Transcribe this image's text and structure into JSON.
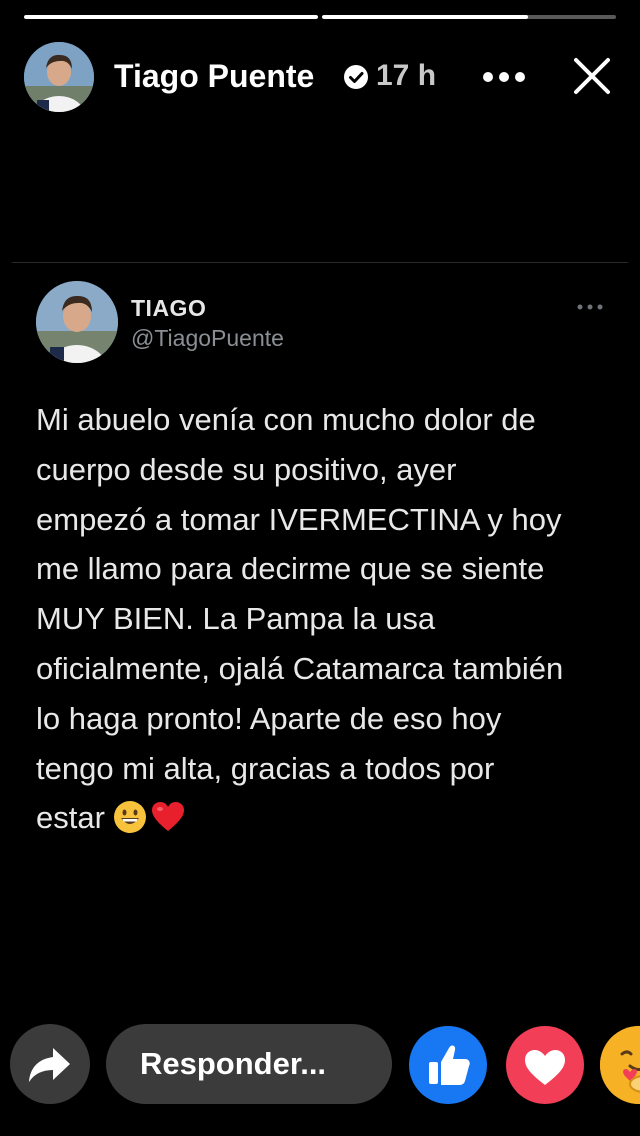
{
  "story": {
    "progress": [
      1.0,
      0.7
    ]
  },
  "header": {
    "name": "Tiago Puente",
    "time": "17 h"
  },
  "tweet": {
    "name": "TIAGO",
    "handle": "@TiagoPuente",
    "text": "Mi abuelo venía con mucho dolor de\ncuerpo desde su positivo, ayer\nempezó a tomar IVERMECTINA y hoy\nme llamo para decirme que se siente\nMUY BIEN. La Pampa la usa\noficialmente, ojalá Catamarca también\nlo haga pronto! Aparte de eso hoy\ntengo mi alta, gracias a todos por\nestar",
    "emojis": [
      "grinning-face-emoji",
      "red-heart-emoji"
    ]
  },
  "footer": {
    "reply_placeholder": "Responder...",
    "reactions": [
      "like",
      "love",
      "care"
    ]
  },
  "colors": {
    "like": "#1877f2",
    "love": "#f33e58",
    "care": "#f7b125"
  }
}
